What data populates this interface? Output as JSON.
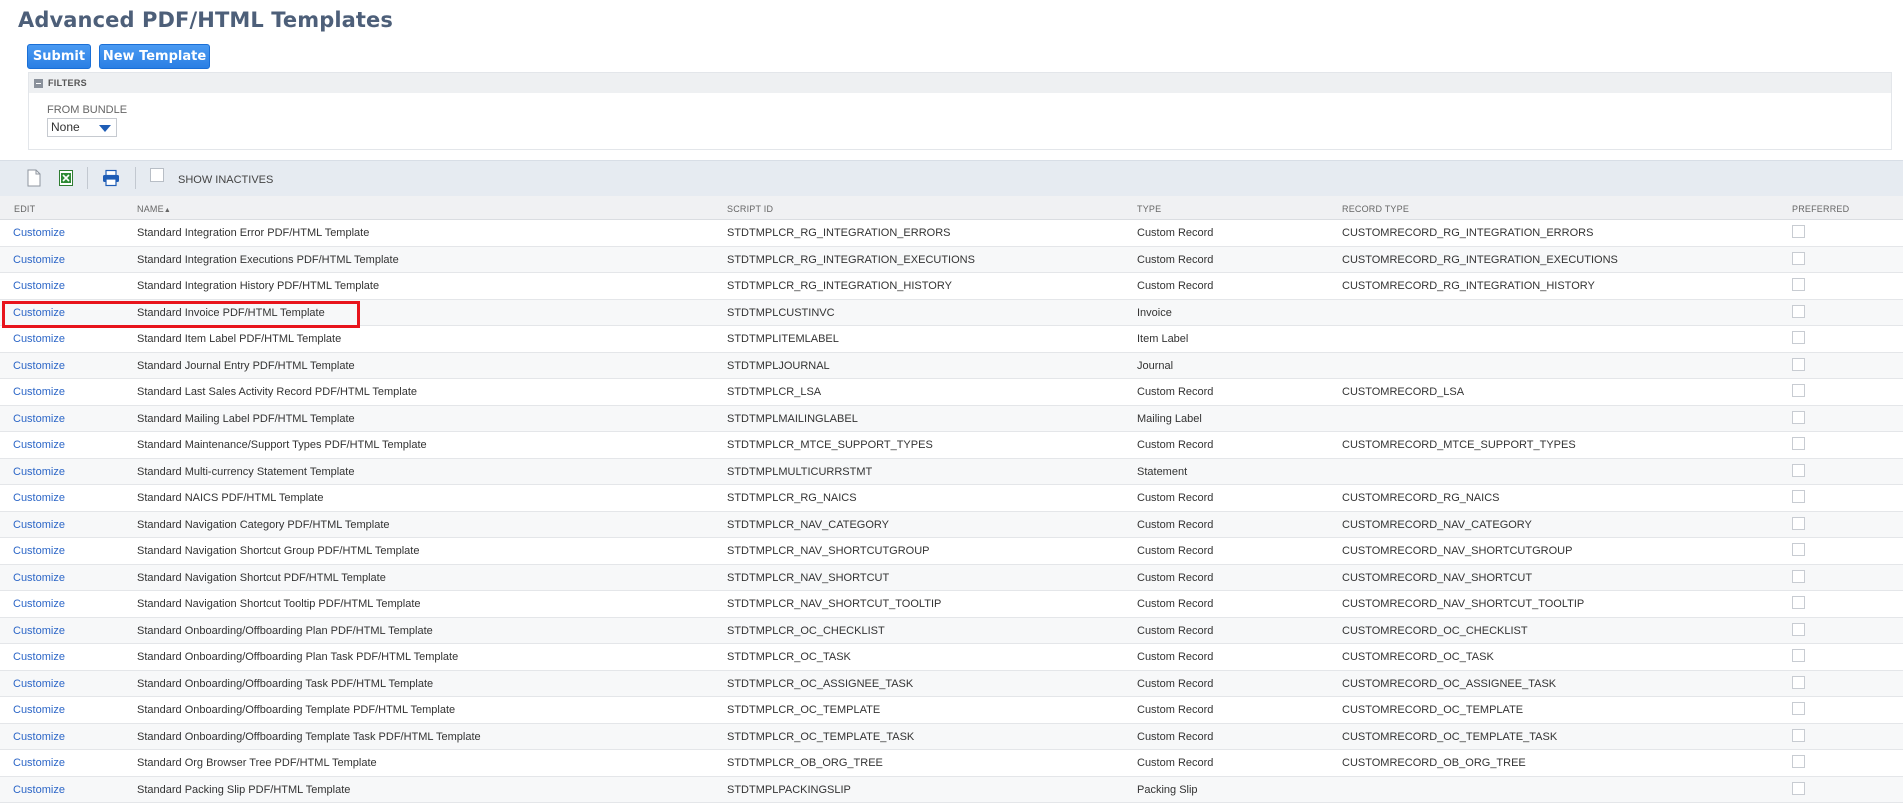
{
  "page": {
    "title": "Advanced PDF/HTML Templates"
  },
  "buttons": {
    "submit": "Submit",
    "new_template": "New Template"
  },
  "filters": {
    "title": "FILTERS",
    "from_bundle_label": "FROM BUNDLE",
    "from_bundle_value": "None"
  },
  "toolbar": {
    "show_inactives_label": "SHOW INACTIVES"
  },
  "columns": {
    "edit": "EDIT",
    "name": "NAME",
    "script_id": "SCRIPT ID",
    "type": "TYPE",
    "record_type": "RECORD TYPE",
    "preferred": "PREFERRED"
  },
  "rows": [
    {
      "edit": "Customize",
      "name": "Standard Integration Error PDF/HTML Template",
      "script_id": "STDTMPLCR_RG_INTEGRATION_ERRORS",
      "type": "Custom Record",
      "record_type": "CUSTOMRECORD_RG_INTEGRATION_ERRORS"
    },
    {
      "edit": "Customize",
      "name": "Standard Integration Executions PDF/HTML Template",
      "script_id": "STDTMPLCR_RG_INTEGRATION_EXECUTIONS",
      "type": "Custom Record",
      "record_type": "CUSTOMRECORD_RG_INTEGRATION_EXECUTIONS"
    },
    {
      "edit": "Customize",
      "name": "Standard Integration History PDF/HTML Template",
      "script_id": "STDTMPLCR_RG_INTEGRATION_HISTORY",
      "type": "Custom Record",
      "record_type": "CUSTOMRECORD_RG_INTEGRATION_HISTORY"
    },
    {
      "edit": "Customize",
      "name": "Standard Invoice PDF/HTML Template",
      "script_id": "STDTMPLCUSTINVC",
      "type": "Invoice",
      "record_type": ""
    },
    {
      "edit": "Customize",
      "name": "Standard Item Label PDF/HTML Template",
      "script_id": "STDTMPLITEMLABEL",
      "type": "Item Label",
      "record_type": ""
    },
    {
      "edit": "Customize",
      "name": "Standard Journal Entry PDF/HTML Template",
      "script_id": "STDTMPLJOURNAL",
      "type": "Journal",
      "record_type": ""
    },
    {
      "edit": "Customize",
      "name": "Standard Last Sales Activity Record PDF/HTML Template",
      "script_id": "STDTMPLCR_LSA",
      "type": "Custom Record",
      "record_type": "CUSTOMRECORD_LSA"
    },
    {
      "edit": "Customize",
      "name": "Standard Mailing Label PDF/HTML Template",
      "script_id": "STDTMPLMAILINGLABEL",
      "type": "Mailing Label",
      "record_type": ""
    },
    {
      "edit": "Customize",
      "name": "Standard Maintenance/Support Types PDF/HTML Template",
      "script_id": "STDTMPLCR_MTCE_SUPPORT_TYPES",
      "type": "Custom Record",
      "record_type": "CUSTOMRECORD_MTCE_SUPPORT_TYPES"
    },
    {
      "edit": "Customize",
      "name": "Standard Multi-currency Statement Template",
      "script_id": "STDTMPLMULTICURRSTMT",
      "type": "Statement",
      "record_type": ""
    },
    {
      "edit": "Customize",
      "name": "Standard NAICS PDF/HTML Template",
      "script_id": "STDTMPLCR_RG_NAICS",
      "type": "Custom Record",
      "record_type": "CUSTOMRECORD_RG_NAICS"
    },
    {
      "edit": "Customize",
      "name": "Standard Navigation Category PDF/HTML Template",
      "script_id": "STDTMPLCR_NAV_CATEGORY",
      "type": "Custom Record",
      "record_type": "CUSTOMRECORD_NAV_CATEGORY"
    },
    {
      "edit": "Customize",
      "name": "Standard Navigation Shortcut Group PDF/HTML Template",
      "script_id": "STDTMPLCR_NAV_SHORTCUTGROUP",
      "type": "Custom Record",
      "record_type": "CUSTOMRECORD_NAV_SHORTCUTGROUP"
    },
    {
      "edit": "Customize",
      "name": "Standard Navigation Shortcut PDF/HTML Template",
      "script_id": "STDTMPLCR_NAV_SHORTCUT",
      "type": "Custom Record",
      "record_type": "CUSTOMRECORD_NAV_SHORTCUT"
    },
    {
      "edit": "Customize",
      "name": "Standard Navigation Shortcut Tooltip PDF/HTML Template",
      "script_id": "STDTMPLCR_NAV_SHORTCUT_TOOLTIP",
      "type": "Custom Record",
      "record_type": "CUSTOMRECORD_NAV_SHORTCUT_TOOLTIP"
    },
    {
      "edit": "Customize",
      "name": "Standard Onboarding/Offboarding Plan PDF/HTML Template",
      "script_id": "STDTMPLCR_OC_CHECKLIST",
      "type": "Custom Record",
      "record_type": "CUSTOMRECORD_OC_CHECKLIST"
    },
    {
      "edit": "Customize",
      "name": "Standard Onboarding/Offboarding Plan Task PDF/HTML Template",
      "script_id": "STDTMPLCR_OC_TASK",
      "type": "Custom Record",
      "record_type": "CUSTOMRECORD_OC_TASK"
    },
    {
      "edit": "Customize",
      "name": "Standard Onboarding/Offboarding Task PDF/HTML Template",
      "script_id": "STDTMPLCR_OC_ASSIGNEE_TASK",
      "type": "Custom Record",
      "record_type": "CUSTOMRECORD_OC_ASSIGNEE_TASK"
    },
    {
      "edit": "Customize",
      "name": "Standard Onboarding/Offboarding Template PDF/HTML Template",
      "script_id": "STDTMPLCR_OC_TEMPLATE",
      "type": "Custom Record",
      "record_type": "CUSTOMRECORD_OC_TEMPLATE"
    },
    {
      "edit": "Customize",
      "name": "Standard Onboarding/Offboarding Template Task PDF/HTML Template",
      "script_id": "STDTMPLCR_OC_TEMPLATE_TASK",
      "type": "Custom Record",
      "record_type": "CUSTOMRECORD_OC_TEMPLATE_TASK"
    },
    {
      "edit": "Customize",
      "name": "Standard Org Browser Tree PDF/HTML Template",
      "script_id": "STDTMPLCR_OB_ORG_TREE",
      "type": "Custom Record",
      "record_type": "CUSTOMRECORD_OB_ORG_TREE"
    },
    {
      "edit": "Customize",
      "name": "Standard Packing Slip PDF/HTML Template",
      "script_id": "STDTMPLPACKINGSLIP",
      "type": "Packing Slip",
      "record_type": ""
    }
  ]
}
